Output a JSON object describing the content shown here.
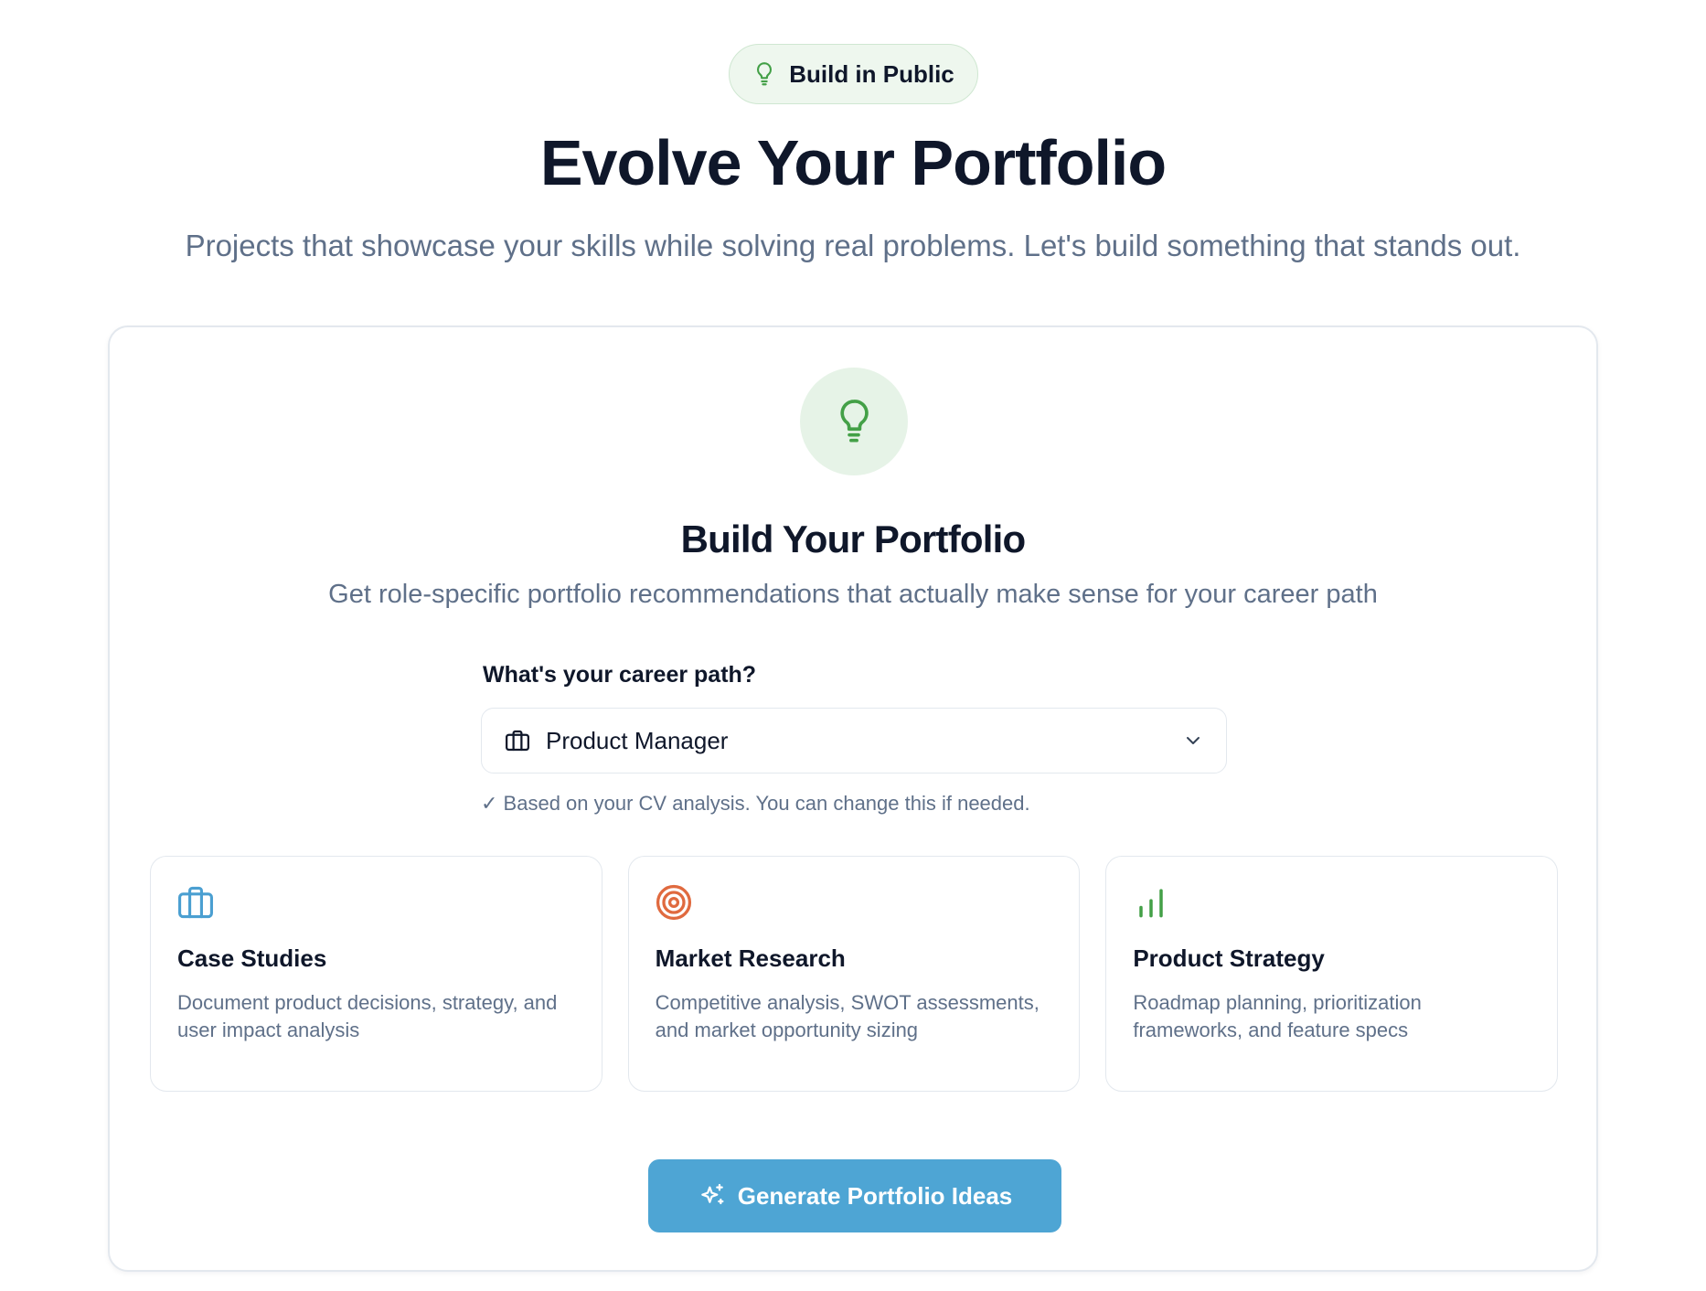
{
  "badge": {
    "label": "Build in Public",
    "icon": "lightbulb-icon"
  },
  "hero": {
    "title": "Evolve Your Portfolio",
    "subtitle": "Projects that showcase your skills while solving real problems. Let's build something that stands out."
  },
  "card": {
    "icon": "lightbulb-icon",
    "title": "Build Your Portfolio",
    "subtitle": "Get role-specific portfolio recommendations that actually make sense for your career path",
    "field_label": "What's your career path?",
    "select": {
      "value": "Product Manager",
      "icon": "briefcase-icon"
    },
    "hint": "✓ Based on your CV analysis. You can change this if needed.",
    "features": [
      {
        "icon": "briefcase-icon",
        "title": "Case Studies",
        "description": "Document product decisions, strategy, and user impact analysis"
      },
      {
        "icon": "target-icon",
        "title": "Market Research",
        "description": "Competitive analysis, SWOT assessments, and market opportunity sizing"
      },
      {
        "icon": "bar-chart-icon",
        "title": "Product Strategy",
        "description": "Roadmap planning, prioritization frameworks, and feature specs"
      }
    ],
    "button": {
      "label": "Generate Portfolio Ideas",
      "icon": "sparkles-icon"
    }
  },
  "colors": {
    "accent_green": "#43a047",
    "button_blue": "#4ea5d4",
    "icon_blue": "#4a9fd1",
    "icon_orange": "#e06a3f",
    "muted_text": "#5f7089",
    "heading_text": "#0f172a"
  }
}
